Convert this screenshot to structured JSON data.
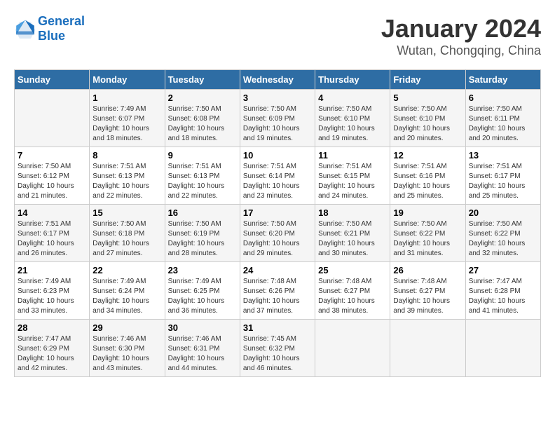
{
  "header": {
    "logo_line1": "General",
    "logo_line2": "Blue",
    "main_title": "January 2024",
    "sub_title": "Wutan, Chongqing, China"
  },
  "calendar": {
    "days_of_week": [
      "Sunday",
      "Monday",
      "Tuesday",
      "Wednesday",
      "Thursday",
      "Friday",
      "Saturday"
    ],
    "weeks": [
      [
        {
          "day": "",
          "sunrise": "",
          "sunset": "",
          "daylight": ""
        },
        {
          "day": "1",
          "sunrise": "Sunrise: 7:49 AM",
          "sunset": "Sunset: 6:07 PM",
          "daylight": "Daylight: 10 hours and 18 minutes."
        },
        {
          "day": "2",
          "sunrise": "Sunrise: 7:50 AM",
          "sunset": "Sunset: 6:08 PM",
          "daylight": "Daylight: 10 hours and 18 minutes."
        },
        {
          "day": "3",
          "sunrise": "Sunrise: 7:50 AM",
          "sunset": "Sunset: 6:09 PM",
          "daylight": "Daylight: 10 hours and 19 minutes."
        },
        {
          "day": "4",
          "sunrise": "Sunrise: 7:50 AM",
          "sunset": "Sunset: 6:10 PM",
          "daylight": "Daylight: 10 hours and 19 minutes."
        },
        {
          "day": "5",
          "sunrise": "Sunrise: 7:50 AM",
          "sunset": "Sunset: 6:10 PM",
          "daylight": "Daylight: 10 hours and 20 minutes."
        },
        {
          "day": "6",
          "sunrise": "Sunrise: 7:50 AM",
          "sunset": "Sunset: 6:11 PM",
          "daylight": "Daylight: 10 hours and 20 minutes."
        }
      ],
      [
        {
          "day": "7",
          "sunrise": "Sunrise: 7:50 AM",
          "sunset": "Sunset: 6:12 PM",
          "daylight": "Daylight: 10 hours and 21 minutes."
        },
        {
          "day": "8",
          "sunrise": "Sunrise: 7:51 AM",
          "sunset": "Sunset: 6:13 PM",
          "daylight": "Daylight: 10 hours and 22 minutes."
        },
        {
          "day": "9",
          "sunrise": "Sunrise: 7:51 AM",
          "sunset": "Sunset: 6:13 PM",
          "daylight": "Daylight: 10 hours and 22 minutes."
        },
        {
          "day": "10",
          "sunrise": "Sunrise: 7:51 AM",
          "sunset": "Sunset: 6:14 PM",
          "daylight": "Daylight: 10 hours and 23 minutes."
        },
        {
          "day": "11",
          "sunrise": "Sunrise: 7:51 AM",
          "sunset": "Sunset: 6:15 PM",
          "daylight": "Daylight: 10 hours and 24 minutes."
        },
        {
          "day": "12",
          "sunrise": "Sunrise: 7:51 AM",
          "sunset": "Sunset: 6:16 PM",
          "daylight": "Daylight: 10 hours and 25 minutes."
        },
        {
          "day": "13",
          "sunrise": "Sunrise: 7:51 AM",
          "sunset": "Sunset: 6:17 PM",
          "daylight": "Daylight: 10 hours and 25 minutes."
        }
      ],
      [
        {
          "day": "14",
          "sunrise": "Sunrise: 7:51 AM",
          "sunset": "Sunset: 6:17 PM",
          "daylight": "Daylight: 10 hours and 26 minutes."
        },
        {
          "day": "15",
          "sunrise": "Sunrise: 7:50 AM",
          "sunset": "Sunset: 6:18 PM",
          "daylight": "Daylight: 10 hours and 27 minutes."
        },
        {
          "day": "16",
          "sunrise": "Sunrise: 7:50 AM",
          "sunset": "Sunset: 6:19 PM",
          "daylight": "Daylight: 10 hours and 28 minutes."
        },
        {
          "day": "17",
          "sunrise": "Sunrise: 7:50 AM",
          "sunset": "Sunset: 6:20 PM",
          "daylight": "Daylight: 10 hours and 29 minutes."
        },
        {
          "day": "18",
          "sunrise": "Sunrise: 7:50 AM",
          "sunset": "Sunset: 6:21 PM",
          "daylight": "Daylight: 10 hours and 30 minutes."
        },
        {
          "day": "19",
          "sunrise": "Sunrise: 7:50 AM",
          "sunset": "Sunset: 6:22 PM",
          "daylight": "Daylight: 10 hours and 31 minutes."
        },
        {
          "day": "20",
          "sunrise": "Sunrise: 7:50 AM",
          "sunset": "Sunset: 6:22 PM",
          "daylight": "Daylight: 10 hours and 32 minutes."
        }
      ],
      [
        {
          "day": "21",
          "sunrise": "Sunrise: 7:49 AM",
          "sunset": "Sunset: 6:23 PM",
          "daylight": "Daylight: 10 hours and 33 minutes."
        },
        {
          "day": "22",
          "sunrise": "Sunrise: 7:49 AM",
          "sunset": "Sunset: 6:24 PM",
          "daylight": "Daylight: 10 hours and 34 minutes."
        },
        {
          "day": "23",
          "sunrise": "Sunrise: 7:49 AM",
          "sunset": "Sunset: 6:25 PM",
          "daylight": "Daylight: 10 hours and 36 minutes."
        },
        {
          "day": "24",
          "sunrise": "Sunrise: 7:48 AM",
          "sunset": "Sunset: 6:26 PM",
          "daylight": "Daylight: 10 hours and 37 minutes."
        },
        {
          "day": "25",
          "sunrise": "Sunrise: 7:48 AM",
          "sunset": "Sunset: 6:27 PM",
          "daylight": "Daylight: 10 hours and 38 minutes."
        },
        {
          "day": "26",
          "sunrise": "Sunrise: 7:48 AM",
          "sunset": "Sunset: 6:27 PM",
          "daylight": "Daylight: 10 hours and 39 minutes."
        },
        {
          "day": "27",
          "sunrise": "Sunrise: 7:47 AM",
          "sunset": "Sunset: 6:28 PM",
          "daylight": "Daylight: 10 hours and 41 minutes."
        }
      ],
      [
        {
          "day": "28",
          "sunrise": "Sunrise: 7:47 AM",
          "sunset": "Sunset: 6:29 PM",
          "daylight": "Daylight: 10 hours and 42 minutes."
        },
        {
          "day": "29",
          "sunrise": "Sunrise: 7:46 AM",
          "sunset": "Sunset: 6:30 PM",
          "daylight": "Daylight: 10 hours and 43 minutes."
        },
        {
          "day": "30",
          "sunrise": "Sunrise: 7:46 AM",
          "sunset": "Sunset: 6:31 PM",
          "daylight": "Daylight: 10 hours and 44 minutes."
        },
        {
          "day": "31",
          "sunrise": "Sunrise: 7:45 AM",
          "sunset": "Sunset: 6:32 PM",
          "daylight": "Daylight: 10 hours and 46 minutes."
        },
        {
          "day": "",
          "sunrise": "",
          "sunset": "",
          "daylight": ""
        },
        {
          "day": "",
          "sunrise": "",
          "sunset": "",
          "daylight": ""
        },
        {
          "day": "",
          "sunrise": "",
          "sunset": "",
          "daylight": ""
        }
      ]
    ]
  }
}
